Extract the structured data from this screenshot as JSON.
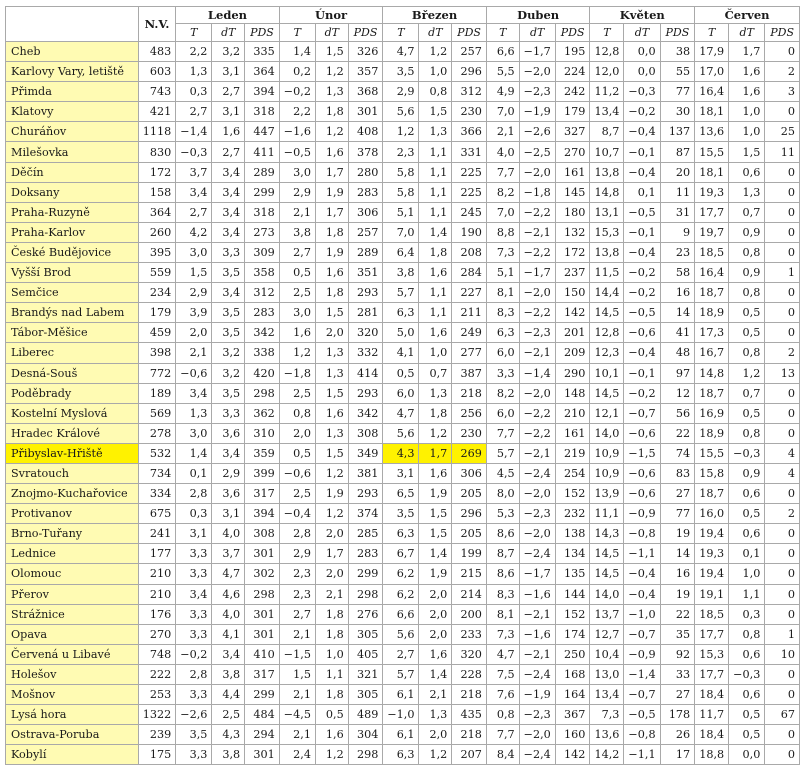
{
  "headers": {
    "nv": "N.V.",
    "months": [
      "Leden",
      "Únor",
      "Březen",
      "Duben",
      "Květen",
      "Červen"
    ],
    "sub": [
      "T",
      "dT",
      "PDS"
    ]
  },
  "highlight": {
    "row_color": "#fffbb3",
    "strong_color": "#fff200",
    "strong_row": "Přibyslav-Hřiště",
    "strong_cells": [
      "Březen.T",
      "Březen.dT",
      "Březen.PDS"
    ]
  },
  "rows": [
    {
      "station": "Cheb",
      "nv": "483",
      "v": [
        "2,2",
        "3,2",
        "335",
        "1,4",
        "1,5",
        "326",
        "4,7",
        "1,2",
        "257",
        "6,6",
        "−1,7",
        "195",
        "12,8",
        "0,0",
        "38",
        "17,9",
        "1,7",
        "0"
      ]
    },
    {
      "station": "Karlovy Vary, letiště",
      "nv": "603",
      "v": [
        "1,3",
        "3,1",
        "364",
        "0,2",
        "1,2",
        "357",
        "3,5",
        "1,0",
        "296",
        "5,5",
        "−2,0",
        "224",
        "12,0",
        "0,0",
        "55",
        "17,0",
        "1,6",
        "2"
      ]
    },
    {
      "station": "Přimda",
      "nv": "743",
      "v": [
        "0,3",
        "2,7",
        "394",
        "−0,2",
        "1,3",
        "368",
        "2,9",
        "0,8",
        "312",
        "4,9",
        "−2,3",
        "242",
        "11,2",
        "−0,3",
        "77",
        "16,4",
        "1,6",
        "3"
      ]
    },
    {
      "station": "Klatovy",
      "nv": "421",
      "v": [
        "2,7",
        "3,1",
        "318",
        "2,2",
        "1,8",
        "301",
        "5,6",
        "1,5",
        "230",
        "7,0",
        "−1,9",
        "179",
        "13,4",
        "−0,2",
        "30",
        "18,1",
        "1,0",
        "0"
      ]
    },
    {
      "station": "Churáňov",
      "nv": "1118",
      "v": [
        "−1,4",
        "1,6",
        "447",
        "−1,6",
        "1,2",
        "408",
        "1,2",
        "1,3",
        "366",
        "2,1",
        "−2,6",
        "327",
        "8,7",
        "−0,4",
        "137",
        "13,6",
        "1,0",
        "25"
      ]
    },
    {
      "station": "Milešovka",
      "nv": "830",
      "v": [
        "−0,3",
        "2,7",
        "411",
        "−0,5",
        "1,6",
        "378",
        "2,3",
        "1,1",
        "331",
        "4,0",
        "−2,5",
        "270",
        "10,7",
        "−0,1",
        "87",
        "15,5",
        "1,5",
        "11"
      ]
    },
    {
      "station": "Děčín",
      "nv": "172",
      "v": [
        "3,7",
        "3,4",
        "289",
        "3,0",
        "1,7",
        "280",
        "5,8",
        "1,1",
        "225",
        "7,7",
        "−2,0",
        "161",
        "13,8",
        "−0,4",
        "20",
        "18,1",
        "0,6",
        "0"
      ]
    },
    {
      "station": "Doksany",
      "nv": "158",
      "v": [
        "3,4",
        "3,4",
        "299",
        "2,9",
        "1,9",
        "283",
        "5,8",
        "1,1",
        "225",
        "8,2",
        "−1,8",
        "145",
        "14,8",
        "0,1",
        "11",
        "19,3",
        "1,3",
        "0"
      ]
    },
    {
      "station": "Praha-Ruzyně",
      "nv": "364",
      "v": [
        "2,7",
        "3,4",
        "318",
        "2,1",
        "1,7",
        "306",
        "5,1",
        "1,1",
        "245",
        "7,0",
        "−2,2",
        "180",
        "13,1",
        "−0,5",
        "31",
        "17,7",
        "0,7",
        "0"
      ]
    },
    {
      "station": "Praha-Karlov",
      "nv": "260",
      "v": [
        "4,2",
        "3,4",
        "273",
        "3,8",
        "1,8",
        "257",
        "7,0",
        "1,4",
        "190",
        "8,8",
        "−2,1",
        "132",
        "15,3",
        "−0,1",
        "9",
        "19,7",
        "0,9",
        "0"
      ]
    },
    {
      "station": "České Budějovice",
      "nv": "395",
      "v": [
        "3,0",
        "3,3",
        "309",
        "2,7",
        "1,9",
        "289",
        "6,4",
        "1,8",
        "208",
        "7,3",
        "−2,2",
        "172",
        "13,8",
        "−0,4",
        "23",
        "18,5",
        "0,8",
        "0"
      ]
    },
    {
      "station": "Vyšší Brod",
      "nv": "559",
      "v": [
        "1,5",
        "3,5",
        "358",
        "0,5",
        "1,6",
        "351",
        "3,8",
        "1,6",
        "284",
        "5,1",
        "−1,7",
        "237",
        "11,5",
        "−0,2",
        "58",
        "16,4",
        "0,9",
        "1"
      ]
    },
    {
      "station": "Semčice",
      "nv": "234",
      "v": [
        "2,9",
        "3,4",
        "312",
        "2,5",
        "1,8",
        "293",
        "5,7",
        "1,1",
        "227",
        "8,1",
        "−2,0",
        "150",
        "14,4",
        "−0,2",
        "16",
        "18,7",
        "0,8",
        "0"
      ]
    },
    {
      "station": "Brandýs nad Labem",
      "nv": "179",
      "v": [
        "3,9",
        "3,5",
        "283",
        "3,0",
        "1,5",
        "281",
        "6,3",
        "1,1",
        "211",
        "8,3",
        "−2,2",
        "142",
        "14,5",
        "−0,5",
        "14",
        "18,9",
        "0,5",
        "0"
      ]
    },
    {
      "station": "Tábor-Měšice",
      "nv": "459",
      "v": [
        "2,0",
        "3,5",
        "342",
        "1,6",
        "2,0",
        "320",
        "5,0",
        "1,6",
        "249",
        "6,3",
        "−2,3",
        "201",
        "12,8",
        "−0,6",
        "41",
        "17,3",
        "0,5",
        "0"
      ]
    },
    {
      "station": "Liberec",
      "nv": "398",
      "v": [
        "2,1",
        "3,2",
        "338",
        "1,2",
        "1,3",
        "332",
        "4,1",
        "1,0",
        "277",
        "6,0",
        "−2,1",
        "209",
        "12,3",
        "−0,4",
        "48",
        "16,7",
        "0,8",
        "2"
      ]
    },
    {
      "station": "Desná-Souš",
      "nv": "772",
      "v": [
        "−0,6",
        "3,2",
        "420",
        "−1,8",
        "1,3",
        "414",
        "0,5",
        "0,7",
        "387",
        "3,3",
        "−1,4",
        "290",
        "10,1",
        "−0,1",
        "97",
        "14,8",
        "1,2",
        "13"
      ]
    },
    {
      "station": "Poděbrady",
      "nv": "189",
      "v": [
        "3,4",
        "3,5",
        "298",
        "2,5",
        "1,5",
        "293",
        "6,0",
        "1,3",
        "218",
        "8,2",
        "−2,0",
        "148",
        "14,5",
        "−0,2",
        "12",
        "18,7",
        "0,7",
        "0"
      ]
    },
    {
      "station": "Kostelní Myslová",
      "nv": "569",
      "v": [
        "1,3",
        "3,3",
        "362",
        "0,8",
        "1,6",
        "342",
        "4,7",
        "1,8",
        "256",
        "6,0",
        "−2,2",
        "210",
        "12,1",
        "−0,7",
        "56",
        "16,9",
        "0,5",
        "0"
      ]
    },
    {
      "station": "Hradec Králové",
      "nv": "278",
      "v": [
        "3,0",
        "3,6",
        "310",
        "2,0",
        "1,3",
        "308",
        "5,6",
        "1,2",
        "230",
        "7,7",
        "−2,2",
        "161",
        "14,0",
        "−0,6",
        "22",
        "18,9",
        "0,8",
        "0"
      ]
    },
    {
      "station": "Přibyslav-Hřiště",
      "nv": "532",
      "v": [
        "1,4",
        "3,4",
        "359",
        "0,5",
        "1,5",
        "349",
        "4,3",
        "1,7",
        "269",
        "5,7",
        "−2,1",
        "219",
        "10,9",
        "−1,5",
        "74",
        "15,5",
        "−0,3",
        "4"
      ]
    },
    {
      "station": "Svratouch",
      "nv": "734",
      "v": [
        "0,1",
        "2,9",
        "399",
        "−0,6",
        "1,2",
        "381",
        "3,1",
        "1,6",
        "306",
        "4,5",
        "−2,4",
        "254",
        "10,9",
        "−0,6",
        "83",
        "15,8",
        "0,9",
        "4"
      ]
    },
    {
      "station": "Znojmo-Kuchařovice",
      "nv": "334",
      "v": [
        "2,8",
        "3,6",
        "317",
        "2,5",
        "1,9",
        "293",
        "6,5",
        "1,9",
        "205",
        "8,0",
        "−2,0",
        "152",
        "13,9",
        "−0,6",
        "27",
        "18,7",
        "0,6",
        "0"
      ]
    },
    {
      "station": "Protivanov",
      "nv": "675",
      "v": [
        "0,3",
        "3,1",
        "394",
        "−0,4",
        "1,2",
        "374",
        "3,5",
        "1,5",
        "296",
        "5,3",
        "−2,3",
        "232",
        "11,1",
        "−0,9",
        "77",
        "16,0",
        "0,5",
        "2"
      ]
    },
    {
      "station": "Brno-Tuřany",
      "nv": "241",
      "v": [
        "3,1",
        "4,0",
        "308",
        "2,8",
        "2,0",
        "285",
        "6,3",
        "1,5",
        "205",
        "8,6",
        "−2,0",
        "138",
        "14,3",
        "−0,8",
        "19",
        "19,4",
        "0,6",
        "0"
      ]
    },
    {
      "station": "Lednice",
      "nv": "177",
      "v": [
        "3,3",
        "3,7",
        "301",
        "2,9",
        "1,7",
        "283",
        "6,7",
        "1,4",
        "199",
        "8,7",
        "−2,4",
        "134",
        "14,5",
        "−1,1",
        "14",
        "19,3",
        "0,1",
        "0"
      ]
    },
    {
      "station": "Olomouc",
      "nv": "210",
      "v": [
        "3,3",
        "4,7",
        "302",
        "2,3",
        "2,0",
        "299",
        "6,2",
        "1,9",
        "215",
        "8,6",
        "−1,7",
        "135",
        "14,5",
        "−0,4",
        "16",
        "19,4",
        "1,0",
        "0"
      ]
    },
    {
      "station": "Přerov",
      "nv": "210",
      "v": [
        "3,4",
        "4,6",
        "298",
        "2,3",
        "2,1",
        "298",
        "6,2",
        "2,0",
        "214",
        "8,3",
        "−1,6",
        "144",
        "14,0",
        "−0,4",
        "19",
        "19,1",
        "1,1",
        "0"
      ]
    },
    {
      "station": "Strážnice",
      "nv": "176",
      "v": [
        "3,3",
        "4,0",
        "301",
        "2,7",
        "1,8",
        "276",
        "6,6",
        "2,0",
        "200",
        "8,1",
        "−2,1",
        "152",
        "13,7",
        "−1,0",
        "22",
        "18,5",
        "0,3",
        "0"
      ]
    },
    {
      "station": "Opava",
      "nv": "270",
      "v": [
        "3,3",
        "4,1",
        "301",
        "2,1",
        "1,8",
        "305",
        "5,6",
        "2,0",
        "233",
        "7,3",
        "−1,6",
        "174",
        "12,7",
        "−0,7",
        "35",
        "17,7",
        "0,8",
        "1"
      ]
    },
    {
      "station": "Červená u Libavé",
      "nv": "748",
      "v": [
        "−0,2",
        "3,4",
        "410",
        "−1,5",
        "1,0",
        "405",
        "2,7",
        "1,6",
        "320",
        "4,7",
        "−2,1",
        "250",
        "10,4",
        "−0,9",
        "92",
        "15,3",
        "0,6",
        "10"
      ]
    },
    {
      "station": "Holešov",
      "nv": "222",
      "v": [
        "2,8",
        "3,8",
        "317",
        "1,5",
        "1,1",
        "321",
        "5,7",
        "1,4",
        "228",
        "7,5",
        "−2,4",
        "168",
        "13,0",
        "−1,4",
        "33",
        "17,7",
        "−0,3",
        "0"
      ]
    },
    {
      "station": "Mošnov",
      "nv": "253",
      "v": [
        "3,3",
        "4,4",
        "299",
        "2,1",
        "1,8",
        "305",
        "6,1",
        "2,1",
        "218",
        "7,6",
        "−1,9",
        "164",
        "13,4",
        "−0,7",
        "27",
        "18,4",
        "0,6",
        "0"
      ]
    },
    {
      "station": "Lysá hora",
      "nv": "1322",
      "v": [
        "−2,6",
        "2,5",
        "484",
        "−4,5",
        "0,5",
        "489",
        "−1,0",
        "1,3",
        "435",
        "0,8",
        "−2,3",
        "367",
        "7,3",
        "−0,5",
        "178",
        "11,7",
        "0,5",
        "67"
      ]
    },
    {
      "station": "Ostrava-Poruba",
      "nv": "239",
      "v": [
        "3,5",
        "4,3",
        "294",
        "2,1",
        "1,6",
        "304",
        "6,1",
        "2,0",
        "218",
        "7,7",
        "−2,0",
        "160",
        "13,6",
        "−0,8",
        "26",
        "18,4",
        "0,5",
        "0"
      ]
    },
    {
      "station": "Kobylí",
      "nv": "175",
      "v": [
        "3,3",
        "3,8",
        "301",
        "2,4",
        "1,2",
        "298",
        "6,3",
        "1,2",
        "207",
        "8,4",
        "−2,4",
        "142",
        "14,2",
        "−1,1",
        "17",
        "18,8",
        "0,0",
        "0"
      ]
    }
  ]
}
